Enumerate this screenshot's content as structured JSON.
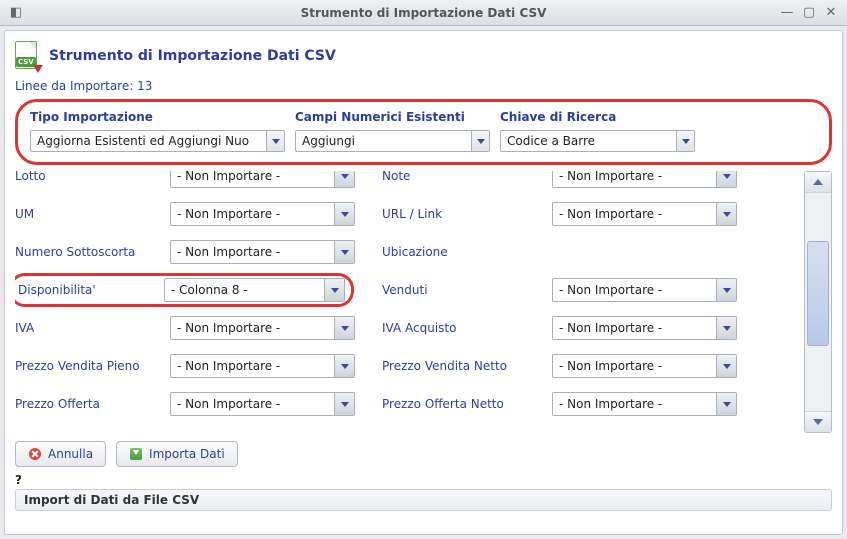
{
  "window_title": "Strumento di Importazione Dati CSV",
  "header_title": "Strumento di Importazione Dati CSV",
  "lines_label": "Linee da Importare: 13",
  "top_group": {
    "tipo_label": "Tipo Importazione",
    "tipo_value": "Aggiorna Esistenti ed Aggiungi Nuo",
    "campi_label": "Campi Numerici Esistenti",
    "campi_value": "Aggiungi",
    "chiave_label": "Chiave di Ricerca",
    "chiave_value": "Codice a Barre"
  },
  "left_fields": [
    {
      "label": "Lotto",
      "value": "- Non Importare -"
    },
    {
      "label": "UM",
      "value": "- Non Importare -"
    },
    {
      "label": "Numero Sottoscorta",
      "value": "- Non Importare -"
    },
    {
      "label": "Disponibilita'",
      "value": "- Colonna 8 -"
    },
    {
      "label": "IVA",
      "value": "- Non Importare -"
    },
    {
      "label": "Prezzo Vendita Pieno",
      "value": "- Non Importare -"
    },
    {
      "label": "Prezzo Offerta",
      "value": "- Non Importare -"
    }
  ],
  "right_fields": [
    {
      "label": "Note",
      "value": "- Non Importare -"
    },
    {
      "label": "URL / Link",
      "value": "- Non Importare -"
    },
    {
      "label": "Ubicazione",
      "value": ""
    },
    {
      "label": "Venduti",
      "value": "- Non Importare -"
    },
    {
      "label": "IVA Acquisto",
      "value": "- Non Importare -"
    },
    {
      "label": "Prezzo Vendita Netto",
      "value": "- Non Importare -"
    },
    {
      "label": "Prezzo Offerta Netto",
      "value": "- Non Importare -"
    }
  ],
  "buttons": {
    "cancel": "Annulla",
    "import": "Importa Dati"
  },
  "status_question": "?",
  "status_bar": "Import di Dati da File CSV"
}
